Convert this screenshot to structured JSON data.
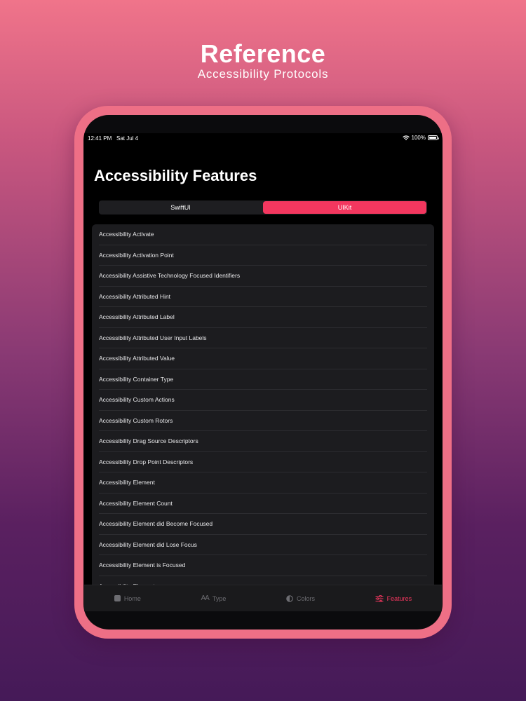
{
  "hero": {
    "title": "Reference",
    "subtitle": "Accessibility Protocols"
  },
  "status_bar": {
    "time": "12:41 PM",
    "date": "Sat Jul 4",
    "battery": "100%",
    "icons": [
      "wifi-icon",
      "battery-icon"
    ]
  },
  "page": {
    "title": "Accessibility Features"
  },
  "segmented_control": {
    "options": [
      "SwiftUI",
      "UIKit"
    ],
    "selected": "UIKit"
  },
  "list": {
    "items": [
      "Accessibility Activate",
      "Accessibility Activation Point",
      "Accessibility Assistive Technology Focused Identifiers",
      "Accessibility Attributed Hint",
      "Accessibility Attributed Label",
      "Accessibility Attributed User Input Labels",
      "Accessibility Attributed Value",
      "Accessibility Container Type",
      "Accessibility Custom Actions",
      "Accessibility Custom Rotors",
      "Accessibility Drag Source Descriptors",
      "Accessibility Drop Point Descriptors",
      "Accessibility Element",
      "Accessibility Element Count",
      "Accessibility Element did Become Focused",
      "Accessibility Element did Lose Focus",
      "Accessibility Element is Focused",
      "Accessibility Elements"
    ]
  },
  "tab_bar": {
    "tabs": [
      {
        "label": "Home",
        "icon": "home-icon"
      },
      {
        "label": "Type",
        "icon": "type-icon"
      },
      {
        "label": "Colors",
        "icon": "colors-icon"
      },
      {
        "label": "Features",
        "icon": "features-icon"
      }
    ],
    "selected": "Features"
  },
  "colors": {
    "accent": "#f3375f",
    "frame": "#ee6f86",
    "list_background": "#1c1c1f",
    "screen_background": "#000000"
  }
}
